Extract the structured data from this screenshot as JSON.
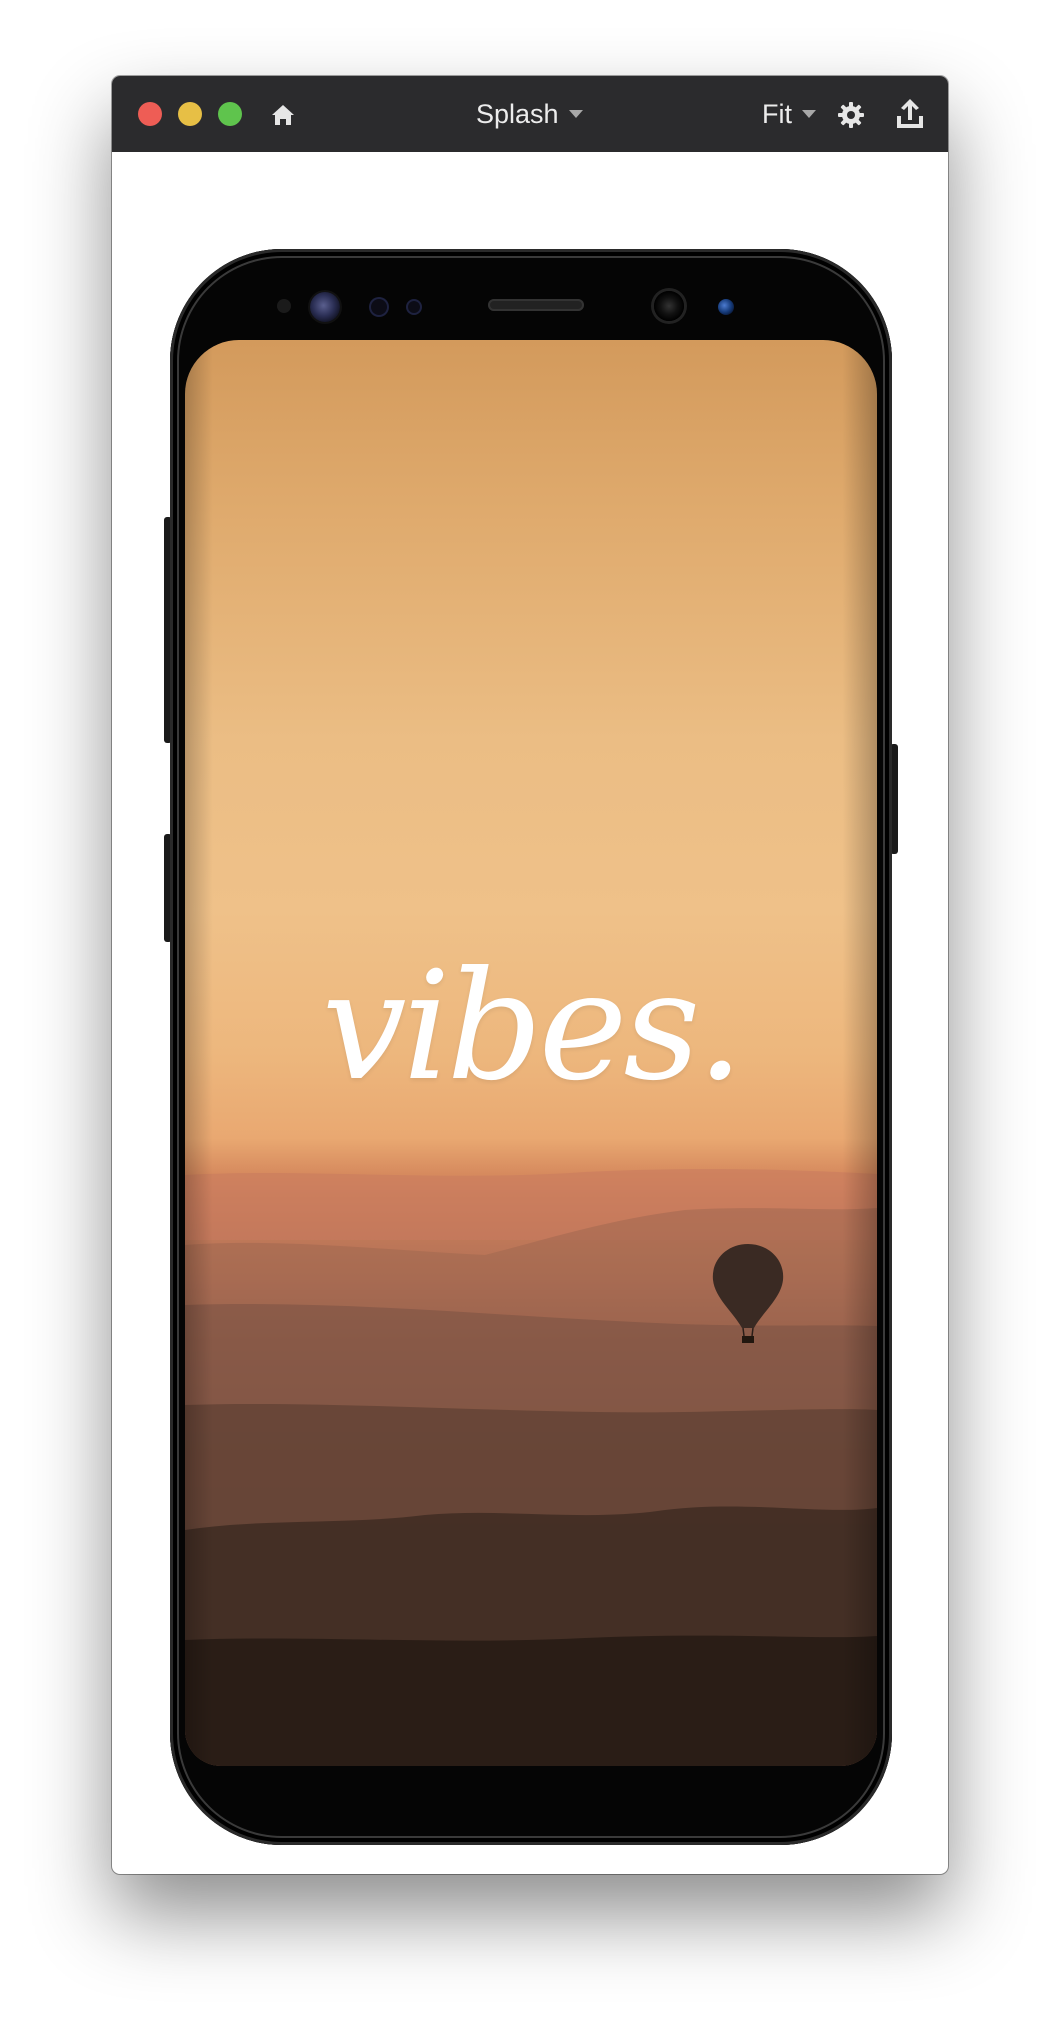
{
  "window": {
    "title": "Splash",
    "zoom_label": "Fit",
    "icons": {
      "home": "home-icon",
      "gear": "gear-icon",
      "share": "share-icon"
    },
    "traffic_lights": {
      "close": "#ee5d55",
      "minimize": "#e7bf45",
      "maximize": "#5fc44d"
    }
  },
  "screen": {
    "brand_text": "vibes."
  },
  "colors": {
    "titlebar": "#2b2b2d",
    "sky_top": "#d39a5c",
    "sky_mid": "#efc189",
    "ground": "#241914"
  }
}
